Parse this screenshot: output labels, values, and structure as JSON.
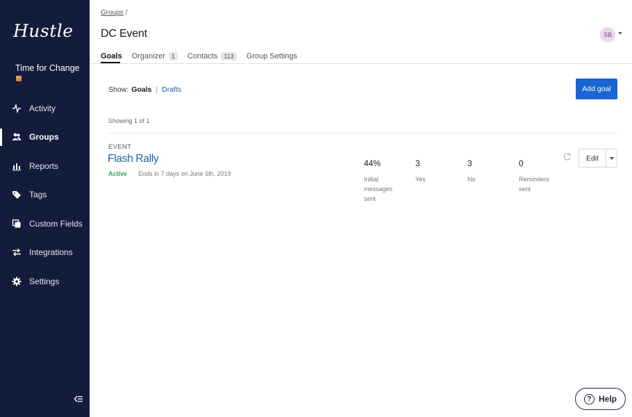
{
  "app": {
    "logo": "Hustle",
    "org_name": "Time for Change"
  },
  "sidebar": {
    "items": [
      {
        "label": "Activity",
        "icon": "activity-icon"
      },
      {
        "label": "Groups",
        "icon": "groups-icon",
        "active": true
      },
      {
        "label": "Reports",
        "icon": "reports-icon"
      },
      {
        "label": "Tags",
        "icon": "tag-icon"
      },
      {
        "label": "Custom Fields",
        "icon": "custom-fields-icon"
      },
      {
        "label": "Integrations",
        "icon": "integrations-icon"
      },
      {
        "label": "Settings",
        "icon": "gear-icon"
      }
    ],
    "collapse_icon": "collapse-sidebar-icon"
  },
  "header": {
    "breadcrumb_link": "Groups",
    "breadcrumb_sep": "/",
    "title": "DC Event",
    "avatar_initials": "SB"
  },
  "tabs": [
    {
      "label": "Goals",
      "active": true
    },
    {
      "label": "Organizer",
      "count": "1"
    },
    {
      "label": "Contacts",
      "count": "113"
    },
    {
      "label": "Group Settings"
    }
  ],
  "filter": {
    "prefix": "Show:",
    "selected": "Goals",
    "separator": "|",
    "other": "Drafts"
  },
  "add_goal_label": "Add goal",
  "showing_text": "Showing 1 of 1",
  "goal": {
    "type": "EVENT",
    "title": "Flash Rally",
    "status": "Active",
    "status_sep": "·",
    "ends_text": "Ends in 7 days on June 5th, 2019",
    "stats": [
      {
        "value": "44%",
        "label_lines": [
          "Initial",
          "messages",
          "sent"
        ]
      },
      {
        "value": "3",
        "label_lines": [
          "Yes"
        ]
      },
      {
        "value": "3",
        "label_lines": [
          "No"
        ]
      },
      {
        "value": "0",
        "label_lines": [
          "Reminders",
          "sent"
        ]
      }
    ],
    "edit_label": "Edit"
  },
  "help_label": "Help",
  "colors": {
    "sidebar_bg": "#131c3b",
    "primary": "#1a64d6",
    "link": "#1b5fb0",
    "active_status": "#2fa653",
    "avatar_bg": "#ead7ee"
  }
}
